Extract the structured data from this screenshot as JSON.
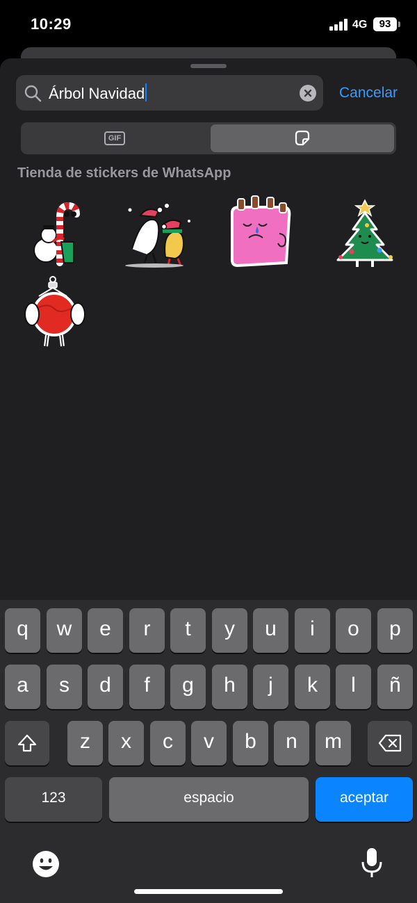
{
  "status_bar": {
    "time": "10:29",
    "network": "4G",
    "battery": "93"
  },
  "search": {
    "value": "Árbol Navidad",
    "cancel_label": "Cancelar"
  },
  "tabs": {
    "gif_label": "GIF",
    "selected": "stickers"
  },
  "section": {
    "title": "Tienda de stickers de WhatsApp"
  },
  "stickers": [
    {
      "icon": "candy-cane-snowman-sticker"
    },
    {
      "icon": "christmas-elves-sticker"
    },
    {
      "icon": "pink-face-sticker"
    },
    {
      "icon": "christmas-tree-sticker"
    },
    {
      "icon": "red-ornament-sticker"
    }
  ],
  "keyboard": {
    "row1": [
      "q",
      "w",
      "e",
      "r",
      "t",
      "y",
      "u",
      "i",
      "o",
      "p"
    ],
    "row2": [
      "a",
      "s",
      "d",
      "f",
      "g",
      "h",
      "j",
      "k",
      "l",
      "ñ"
    ],
    "row3": [
      "z",
      "x",
      "c",
      "v",
      "b",
      "n",
      "m"
    ],
    "numbers_label": "123",
    "space_label": "espacio",
    "return_label": "aceptar"
  },
  "colors": {
    "accent": "#0a84ff",
    "sheet": "#1f1f21",
    "keyboard": "#2c2c2e"
  }
}
